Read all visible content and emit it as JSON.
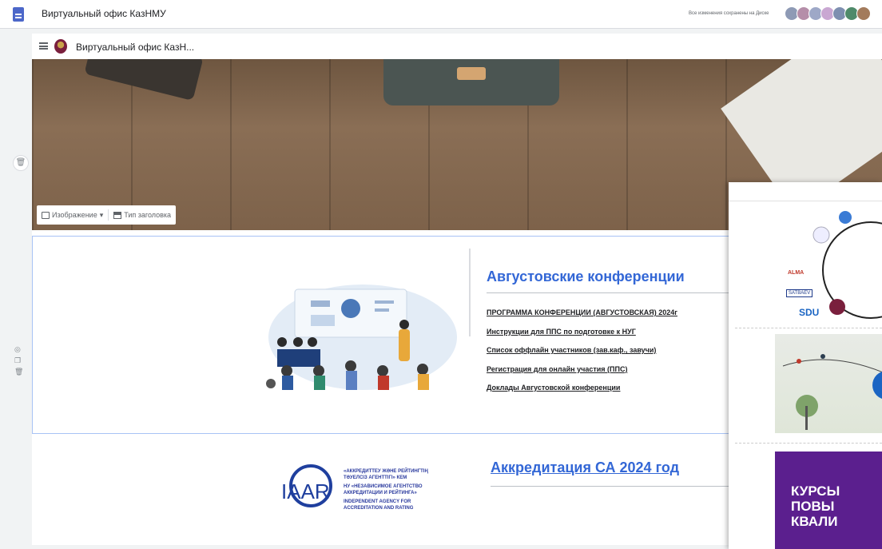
{
  "topbar": {
    "app_title": "Виртуальный офис КазНМУ",
    "save_status": "Все изменения сохранены на Диске",
    "avatar_colors": [
      "#8e9ab5",
      "#b58ea9",
      "#9ea8c7",
      "#c9a7d2",
      "#7e8fb0",
      "#4f8a6a",
      "#a37b5c"
    ]
  },
  "site": {
    "title": "Виртуальный офис КазН..."
  },
  "hero": {
    "image_control_label": "Изображение",
    "header_type_label": "Тип заголовка"
  },
  "conferences": {
    "heading": "Августовские конференции",
    "links": [
      {
        "text": "ПРОГРАММА КОНФЕРЕНЦИИ (АВГУСТОВСКАЯ) 2024г",
        "underlined": true
      },
      {
        "text": "Инструкции для ППС по подготовке к НУГ",
        "underlined": true
      },
      {
        "text": "Список оффлайн участников (зав.каф., завучи)",
        "underlined": true
      },
      {
        "text": "Регистрация для онлайн участия (ППС)",
        "underlined": true
      },
      {
        "text": "Доклады Августовской конференции",
        "underlined": true
      }
    ]
  },
  "accreditation": {
    "heading": "Аккредитация СА 2024 год",
    "logo_text": "IAAR",
    "logo_lines": [
      "«АККРЕДИТТЕУ ЖӘНЕ РЕЙТИНГТІҢ",
      "ТӘУЕЛСІЗ АГЕНТТІГІ» КЕМ",
      "НУ «НЕЗАВИСИМОЕ АГЕНТСТВО",
      "АККРЕДИТАЦИИ И РЕЙТИНГА»",
      "INDEPENDENT AGENCY FOR",
      "ACCREDITATION AND RATING"
    ]
  },
  "preview": {
    "alma": "ALMA",
    "satbaev": "SATBAEV",
    "sdu": "SDU",
    "purple_lines": [
      "КУРСЫ",
      "ПОВЫ",
      "КВАЛИ"
    ]
  },
  "colors": {
    "accent_blue": "#3367d6",
    "purple_banner": "#5b1f8e"
  }
}
